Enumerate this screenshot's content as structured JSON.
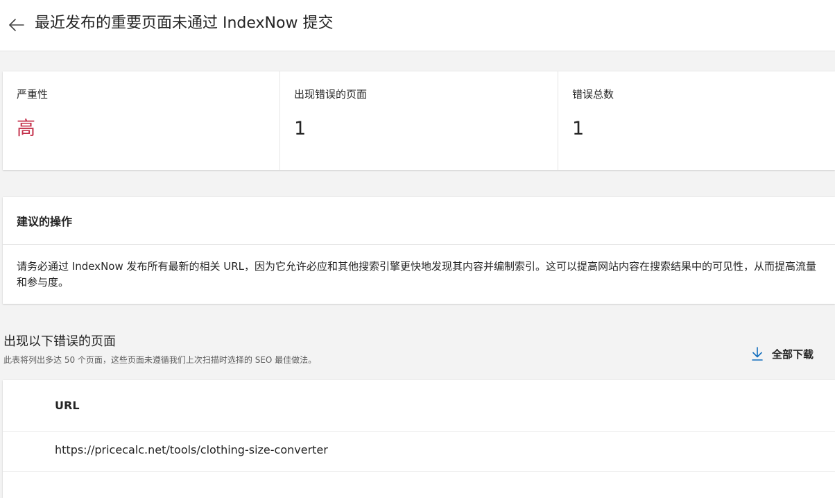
{
  "header": {
    "title": "最近发布的重要页面未通过 IndexNow 提交",
    "back_icon": "arrow-left-icon"
  },
  "stats": [
    {
      "label": "严重性",
      "value": "高",
      "value_color": "#c4314b"
    },
    {
      "label": "出现错误的页面",
      "value": "1"
    },
    {
      "label": "错误总数",
      "value": "1"
    }
  ],
  "recommended_action": {
    "title": "建议的操作",
    "body": "请务必通过 IndexNow 发布所有最新的相关 URL，因为它允许必应和其他搜索引擎更快地发现其内容并编制索引。这可以提高网站内容在搜索结果中的可见性，从而提高流量和参与度。"
  },
  "pages_section": {
    "title": "出现以下错误的页面",
    "subtitle": "此表将列出多达 50 个页面，这些页面未遵循我们上次扫描时选择的 SEO 最佳做法。",
    "download_label": "全部下载",
    "download_icon": "download-icon",
    "accent_color": "#0f6cbd"
  },
  "table": {
    "columns": [
      "URL"
    ],
    "rows": [
      {
        "url": "https://pricecalc.net/tools/clothing-size-converter"
      }
    ]
  }
}
